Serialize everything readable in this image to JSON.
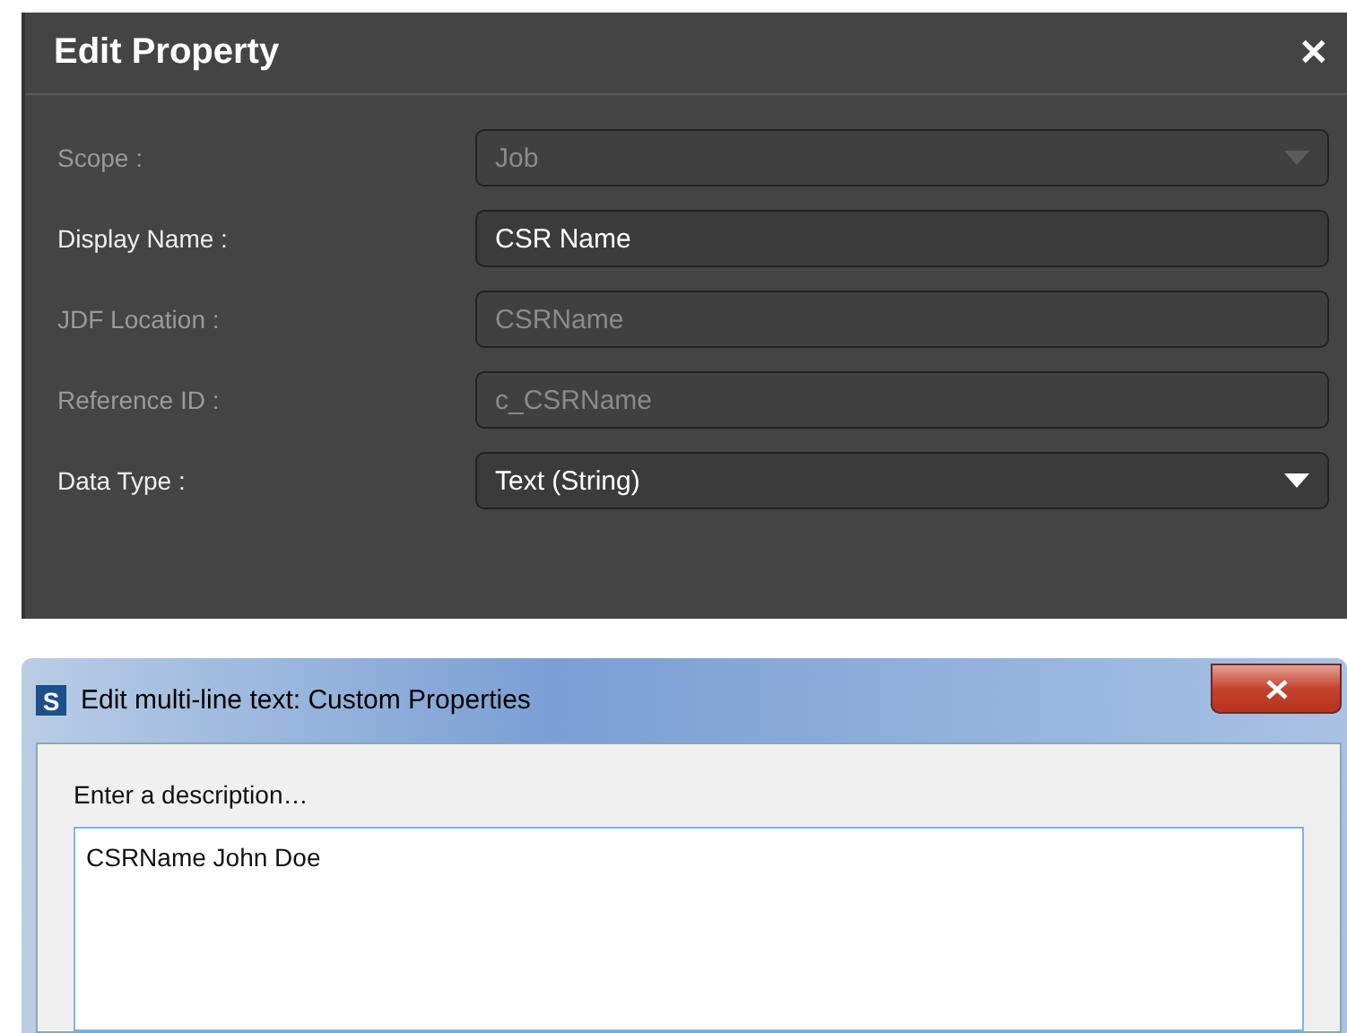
{
  "property_dialog": {
    "title": "Edit Property",
    "close": "✕",
    "fields": [
      {
        "label": "Scope :",
        "kind": "select",
        "value": "Job",
        "disabled": true
      },
      {
        "label": "Display Name :",
        "kind": "text",
        "value": "CSR Name",
        "disabled": false
      },
      {
        "label": "JDF Location :",
        "kind": "text",
        "value": "CSRName",
        "disabled": true
      },
      {
        "label": "Reference ID :",
        "kind": "text",
        "value": "c_CSRName",
        "disabled": true
      },
      {
        "label": "Data Type :",
        "kind": "select",
        "value": "Text (String)",
        "disabled": false
      }
    ]
  },
  "text_dialog": {
    "app_letter": "S",
    "title": "Edit multi-line text: Custom Properties",
    "prompt": "Enter a description…",
    "value": "CSRName John Doe"
  }
}
